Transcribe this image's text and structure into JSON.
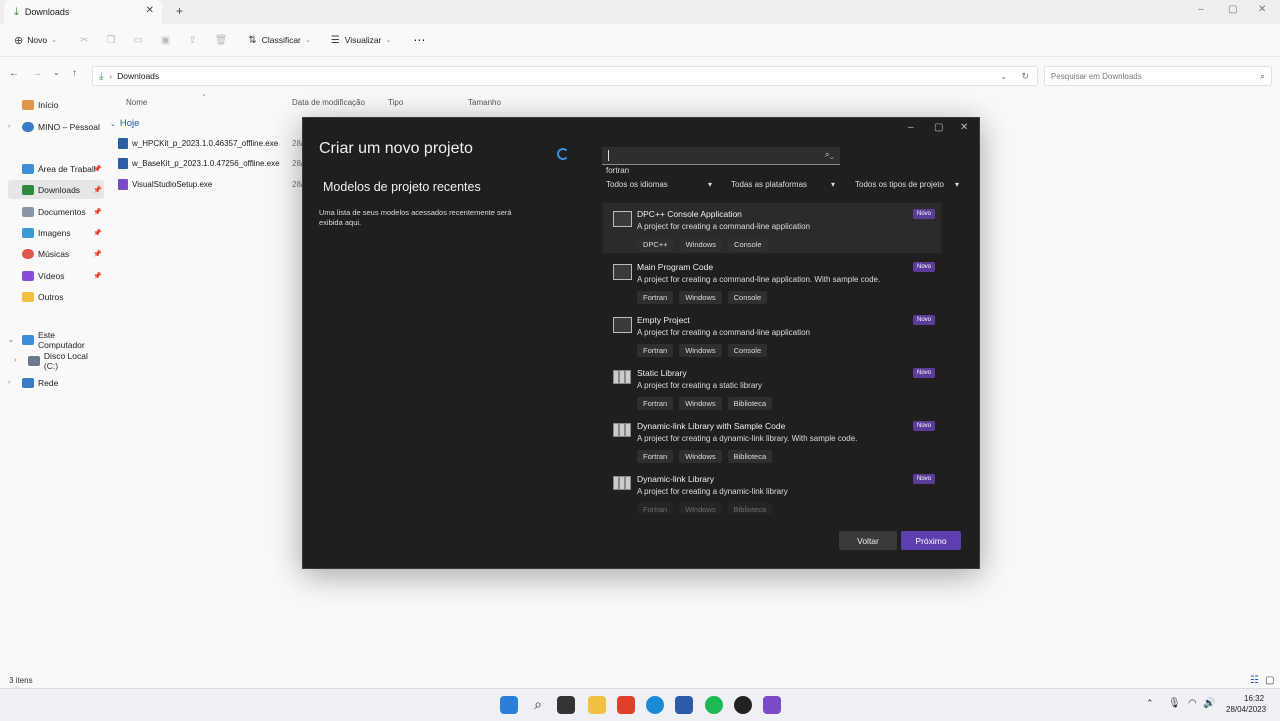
{
  "explorer": {
    "tab_title": "Downloads",
    "toolbar": {
      "new": "Novo",
      "sort": "Classificar",
      "view": "Visualizar",
      "more": "⋯"
    },
    "address": "Downloads",
    "search_placeholder": "Pesquisar em Downloads",
    "sidebar": [
      {
        "label": "Início"
      },
      {
        "label": "MINO – Pessoal"
      },
      {
        "label": "Área de Trabalho"
      },
      {
        "label": "Downloads"
      },
      {
        "label": "Documentos"
      },
      {
        "label": "Imagens"
      },
      {
        "label": "Músicas"
      },
      {
        "label": "Vídeos"
      },
      {
        "label": "Outros"
      },
      {
        "label": "Este Computador"
      },
      {
        "label": "Disco Local (C:)"
      },
      {
        "label": "Rede"
      }
    ],
    "columns": {
      "name": "Nome",
      "modified": "Data de modificação",
      "type": "Tipo",
      "size": "Tamanho"
    },
    "group": "Hoje",
    "files": [
      {
        "name": "w_HPCKit_p_2023.1.0.46357_offline.exe",
        "date": "28/"
      },
      {
        "name": "w_BaseKit_p_2023.1.0.47256_offline.exe",
        "date": "28/"
      },
      {
        "name": "VisualStudioSetup.exe",
        "date": "28/"
      }
    ],
    "status": "3 itens"
  },
  "dialog": {
    "title": "Criar um novo projeto",
    "recent_title": "Modelos de projeto recentes",
    "recent_desc": "Uma lista de seus modelos acessados recentemente será exibida aqui.",
    "search_suggestion": "fortran",
    "filters": [
      "Todos os idiomas",
      "Todas as plataformas",
      "Todos os tipos de projeto"
    ],
    "templates": [
      {
        "name": "DPC++ Console Application",
        "desc": "A project for creating a command-line application",
        "tags": [
          "DPC++",
          "Windows",
          "Console"
        ],
        "badge": "Novo"
      },
      {
        "name": "Main Program Code",
        "desc": "A project for creating a command-line application. With sample code.",
        "tags": [
          "Fortran",
          "Windows",
          "Console"
        ],
        "badge": "Novo"
      },
      {
        "name": "Empty Project",
        "desc": "A project for creating a command-line application",
        "tags": [
          "Fortran",
          "Windows",
          "Console"
        ],
        "badge": "Novo"
      },
      {
        "name": "Static Library",
        "desc": "A project for creating a static library",
        "tags": [
          "Fortran",
          "Windows",
          "Biblioteca"
        ],
        "badge": "Novo"
      },
      {
        "name": "Dynamic-link Library with Sample Code",
        "desc": "A project for creating a dynamic-link library. With sample code.",
        "tags": [
          "Fortran",
          "Windows",
          "Biblioteca"
        ],
        "badge": "Novo"
      },
      {
        "name": "Dynamic-link Library",
        "desc": "A project for creating a dynamic-link library",
        "tags": [
          "Fortran",
          "Windows",
          "Biblioteca"
        ],
        "badge": "Novo"
      }
    ],
    "back_label": "Voltar",
    "next_label": "Próximo"
  },
  "taskbar": {
    "time": "16:32",
    "date": "28/04/2023"
  }
}
